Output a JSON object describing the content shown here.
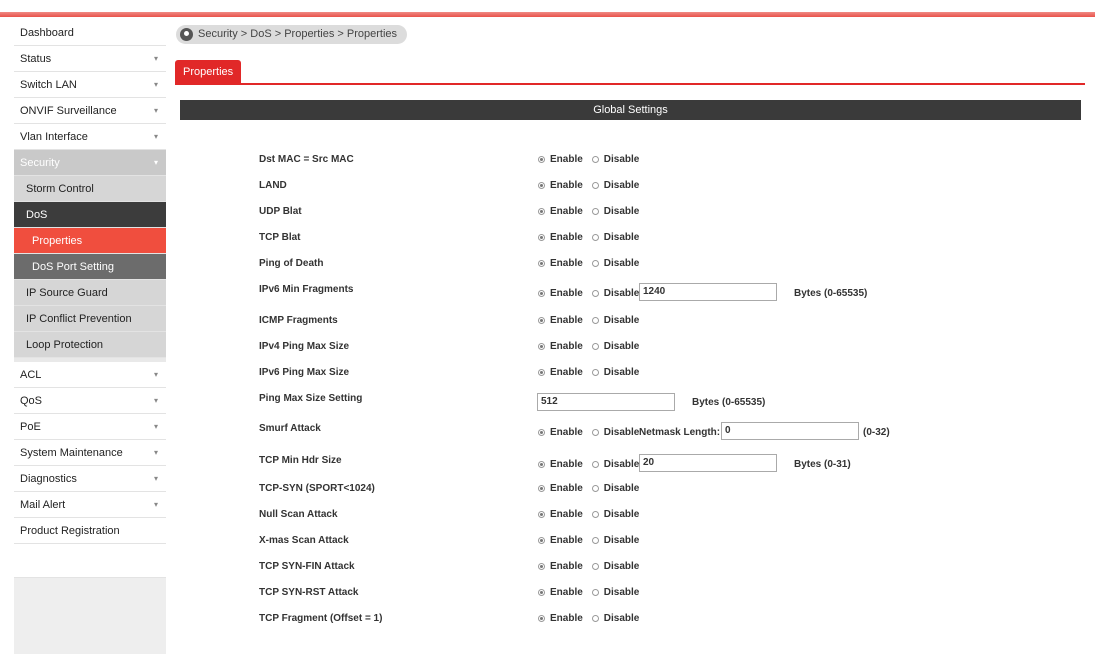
{
  "sidebar": {
    "items": [
      {
        "label": "Dashboard"
      },
      {
        "label": "Status"
      },
      {
        "label": "Switch LAN"
      },
      {
        "label": "ONVIF Surveillance"
      },
      {
        "label": "Vlan Interface"
      },
      {
        "label": "Security"
      },
      {
        "label": "Storm Control"
      },
      {
        "label": "DoS"
      },
      {
        "label": "Properties"
      },
      {
        "label": "DoS Port Setting"
      },
      {
        "label": "IP Source Guard"
      },
      {
        "label": "IP Conflict Prevention"
      },
      {
        "label": "Loop Protection"
      },
      {
        "label": "ACL"
      },
      {
        "label": "QoS"
      },
      {
        "label": "PoE"
      },
      {
        "label": "System Maintenance"
      },
      {
        "label": "Diagnostics"
      },
      {
        "label": "Mail Alert"
      },
      {
        "label": "Product Registration"
      }
    ],
    "chevron": "▾"
  },
  "breadcrumb": "Security > DoS > Properties > Properties",
  "tab": "Properties",
  "section_title": "Global Settings",
  "options": {
    "enable": "Enable",
    "disable": "Disable"
  },
  "rows": [
    {
      "label": "Dst MAC = Src MAC",
      "selected": "enable"
    },
    {
      "label": "LAND",
      "selected": "enable"
    },
    {
      "label": "UDP Blat",
      "selected": "enable"
    },
    {
      "label": "TCP Blat",
      "selected": "enable"
    },
    {
      "label": "Ping of Death",
      "selected": "enable"
    },
    {
      "label": "IPv6 Min Fragments",
      "selected": "enable",
      "value": "1240",
      "unit": "Bytes (0-65535)"
    },
    {
      "label": "ICMP Fragments",
      "selected": "enable"
    },
    {
      "label": "IPv4 Ping Max Size",
      "selected": "enable"
    },
    {
      "label": "IPv6 Ping Max Size",
      "selected": "enable"
    },
    {
      "label": "Ping Max Size Setting",
      "value": "512",
      "unit": "Bytes (0-65535)"
    },
    {
      "label": "Smurf Attack",
      "selected": "enable",
      "extra_label": "Netmask Length:",
      "value": "0",
      "unit": "(0-32)"
    },
    {
      "label": "TCP Min Hdr Size",
      "selected": "enable",
      "value": "20",
      "unit": "Bytes (0-31)"
    },
    {
      "label": "TCP-SYN (SPORT<1024)",
      "selected": "enable"
    },
    {
      "label": "Null Scan Attack",
      "selected": "enable"
    },
    {
      "label": "X-mas Scan Attack",
      "selected": "enable"
    },
    {
      "label": "TCP SYN-FIN Attack",
      "selected": "enable"
    },
    {
      "label": "TCP SYN-RST Attack",
      "selected": "enable"
    },
    {
      "label": "TCP Fragment (Offset = 1)",
      "selected": "enable"
    }
  ]
}
